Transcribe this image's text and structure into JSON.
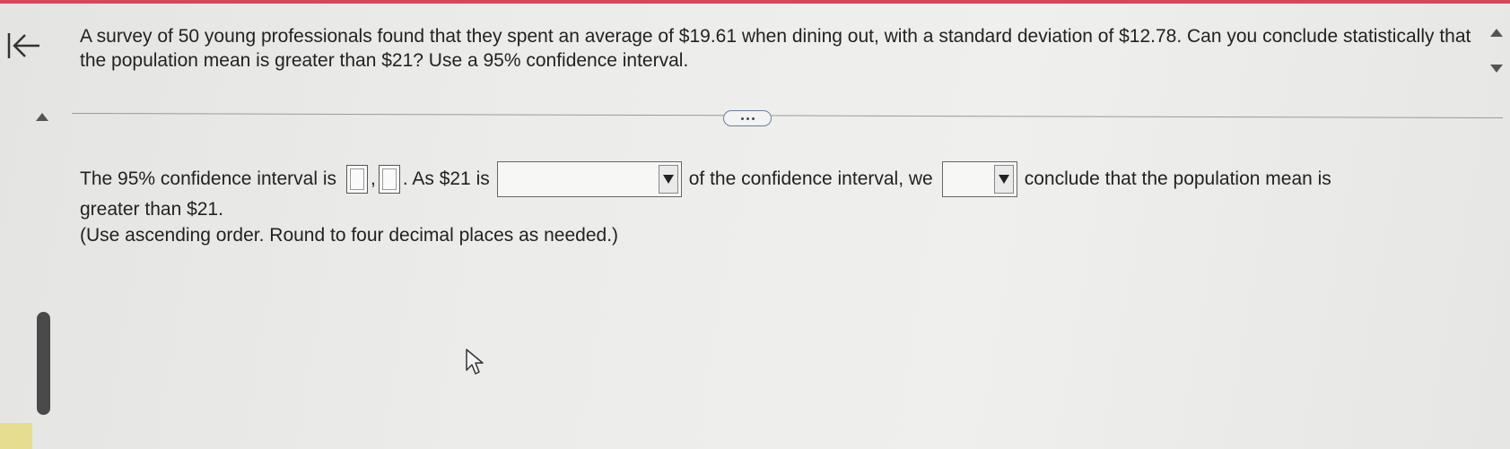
{
  "question": {
    "text": "A survey of 50 young professionals found that they spent an average of $19.61 when dining out, with a standard deviation of $12.78. Can you conclude statistically that the population mean is greater than $21? Use a 95% confidence interval."
  },
  "answer": {
    "prefix": "The 95% confidence interval is",
    "comma": ",",
    "after_interval": ". As $21 is",
    "after_select1": "of the confidence interval, we",
    "after_select2": "conclude that the population mean is",
    "line2": "greater than $21.",
    "instructions": "(Use ascending order. Round to four decimal places as needed.)",
    "lower_bound": "",
    "upper_bound": "",
    "select1_value": "",
    "select2_value": ""
  },
  "colors": {
    "accent_bar": "#d9465a",
    "corner_highlight": "#e6dd8f"
  },
  "icons": {
    "back": "back-to-start-icon",
    "more": "more-options-icon",
    "cursor": "mouse-pointer-icon"
  }
}
